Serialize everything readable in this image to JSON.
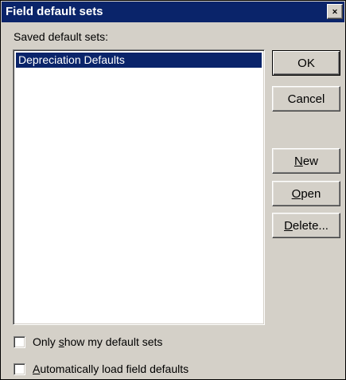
{
  "window": {
    "title": "Field default sets",
    "close_icon": "close-icon"
  },
  "list": {
    "label": "Saved default sets:",
    "items": [
      {
        "label": "Depreciation Defaults",
        "selected": true
      }
    ]
  },
  "buttons": {
    "ok": "OK",
    "cancel": "Cancel",
    "new": {
      "mnemonic": "N",
      "rest": "ew"
    },
    "open": {
      "mnemonic": "O",
      "rest": "pen"
    },
    "delete": {
      "mnemonic": "D",
      "rest": "elete..."
    }
  },
  "options": {
    "only_show_mine": {
      "before": "Only ",
      "mnemonic": "s",
      "after": "how my default sets",
      "checked": false
    },
    "auto_load": {
      "before": "",
      "mnemonic": "A",
      "after": "utomatically load field defaults",
      "checked": false
    }
  },
  "colors": {
    "titlebar": "#0a246a",
    "face": "#d4d0c8",
    "selection": "#0a246a"
  }
}
